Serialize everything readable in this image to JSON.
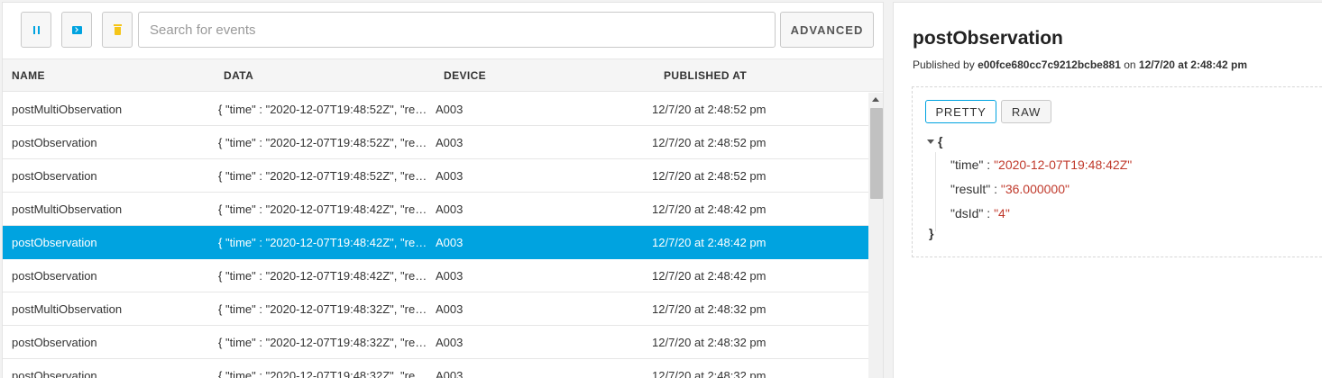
{
  "toolbar": {
    "pause_icon": "pause-icon",
    "console_icon": "console-icon",
    "trash_icon": "trash-icon",
    "search_placeholder": "Search for events",
    "search_value": "",
    "advanced_label": "ADVANCED"
  },
  "table": {
    "columns": [
      "NAME",
      "DATA",
      "DEVICE",
      "PUBLISHED AT"
    ],
    "rows": [
      {
        "name": "postMultiObservation",
        "data": "{ \"time\" : \"2020-12-07T19:48:52Z\", \"result\" : ",
        "device": "A003",
        "published": "12/7/20 at 2:48:52 pm"
      },
      {
        "name": "postObservation",
        "data": "{ \"time\" : \"2020-12-07T19:48:52Z\", \"result\" : ",
        "device": "A003",
        "published": "12/7/20 at 2:48:52 pm"
      },
      {
        "name": "postObservation",
        "data": "{ \"time\" : \"2020-12-07T19:48:52Z\", \"result\" : ",
        "device": "A003",
        "published": "12/7/20 at 2:48:52 pm"
      },
      {
        "name": "postMultiObservation",
        "data": "{ \"time\" : \"2020-12-07T19:48:42Z\", \"result\" : ",
        "device": "A003",
        "published": "12/7/20 at 2:48:42 pm"
      },
      {
        "name": "postObservation",
        "data": "{ \"time\" : \"2020-12-07T19:48:42Z\", \"result\" : ",
        "device": "A003",
        "published": "12/7/20 at 2:48:42 pm"
      },
      {
        "name": "postObservation",
        "data": "{ \"time\" : \"2020-12-07T19:48:42Z\", \"result\" : ",
        "device": "A003",
        "published": "12/7/20 at 2:48:42 pm"
      },
      {
        "name": "postMultiObservation",
        "data": "{ \"time\" : \"2020-12-07T19:48:32Z\", \"result\" : ",
        "device": "A003",
        "published": "12/7/20 at 2:48:32 pm"
      },
      {
        "name": "postObservation",
        "data": "{ \"time\" : \"2020-12-07T19:48:32Z\", \"result\" : ",
        "device": "A003",
        "published": "12/7/20 at 2:48:32 pm"
      },
      {
        "name": "postObservation",
        "data": "{ \"time\" : \"2020-12-07T19:48:32Z\", \"result\" : ",
        "device": "A003",
        "published": "12/7/20 at 2:48:32 pm"
      }
    ],
    "selected_index": 4
  },
  "detail": {
    "title": "postObservation",
    "published_by_label": "Published by",
    "device_id": "e00fce680cc7c9212bcbe881",
    "on_label": "on",
    "published_at": "12/7/20 at 2:48:42 pm",
    "pretty_label": "PRETTY",
    "raw_label": "RAW",
    "expand_icon": "chevron-down-icon",
    "open_brace": "{",
    "close_brace": "}",
    "fields": [
      {
        "key": "\"time\"",
        "value": "\"2020-12-07T19:48:42Z\""
      },
      {
        "key": "\"result\"",
        "value": "\"36.000000\""
      },
      {
        "key": "\"dsId\"",
        "value": "\"4\""
      }
    ],
    "separator": " : "
  },
  "colors": {
    "accent": "#00a3e0",
    "trash": "#f5c518",
    "json_value": "#c0392b"
  }
}
